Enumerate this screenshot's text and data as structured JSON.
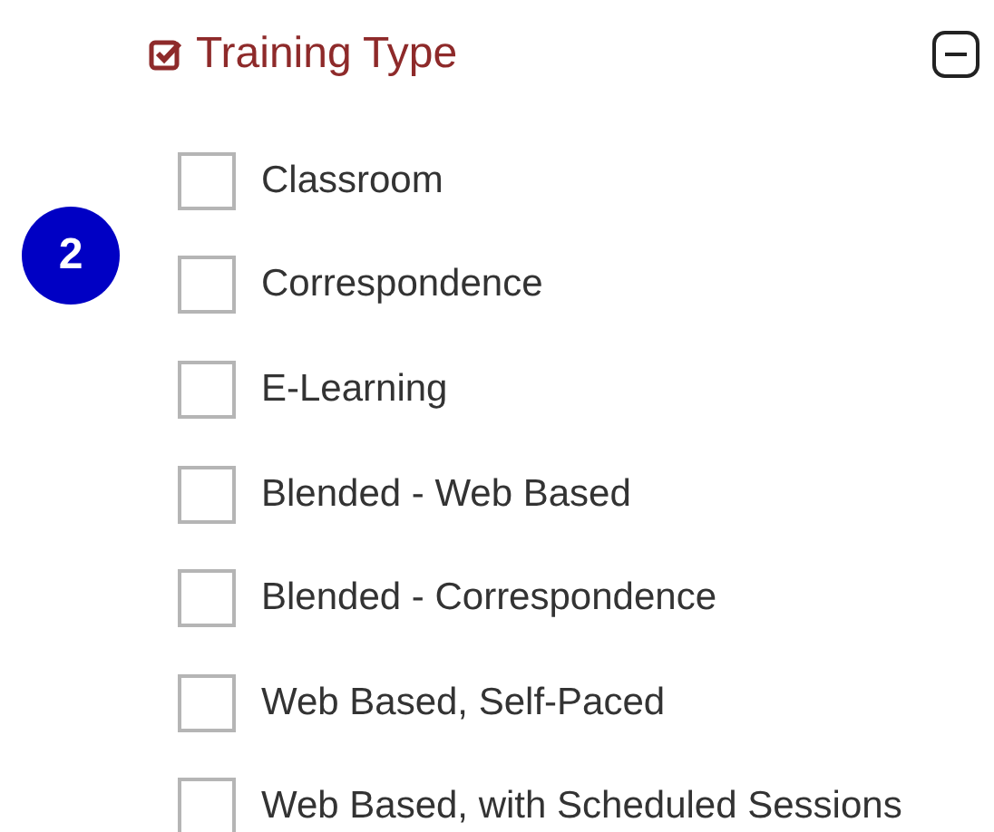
{
  "filter": {
    "title": "Training Type",
    "expanded": true,
    "options": [
      {
        "label": "Classroom",
        "checked": false
      },
      {
        "label": "Correspondence",
        "checked": false
      },
      {
        "label": "E-Learning",
        "checked": false
      },
      {
        "label": "Blended - Web Based",
        "checked": false
      },
      {
        "label": "Blended - Correspondence",
        "checked": false
      },
      {
        "label": "Web Based, Self-Paced",
        "checked": false
      },
      {
        "label": "Web Based, with Scheduled Sessions",
        "checked": false
      }
    ]
  },
  "step_badge": "2"
}
